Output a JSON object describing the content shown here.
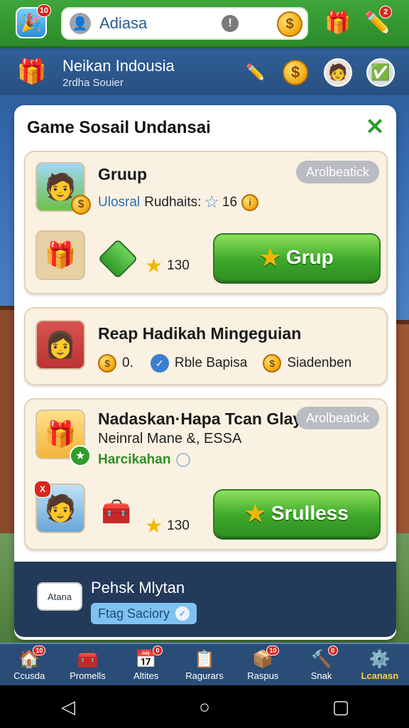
{
  "topbar": {
    "app_badge": "10",
    "search_value": "Adiasa",
    "alert_glyph": "!",
    "coin_glyph": "$",
    "gift_badge": "",
    "pencil_badge": "2"
  },
  "profile": {
    "name": "Neikan Indousia",
    "subtitle": "2rdha Souier"
  },
  "panel": {
    "title": "Game Sosail Undansai",
    "close_glyph": "✕"
  },
  "card1": {
    "title": "Gruup",
    "pill": "Arolbeatick",
    "line_blue": "Ulosral",
    "line_text": "Rudhaits:",
    "line_num": "16",
    "stars": "130",
    "button": "Grup"
  },
  "card2": {
    "title": "Reap Hadikah Mingeguian",
    "v1": "0.",
    "v2": "Rble Bapisa",
    "v3": "Siadenben"
  },
  "card3": {
    "title": "Nadaskan·Hapa Tcan Glay",
    "pill": "Arolbeatick",
    "sub": "Neinral Mane &, ESSA",
    "green_text": "Harcikahan",
    "badge": "X",
    "stars": "130",
    "button": "Srulless"
  },
  "promo": {
    "icon_text": "Atana",
    "title": "Pehsk Mlytan",
    "button": "Ftag Saciory"
  },
  "nav": {
    "items": [
      {
        "label": "Ccusda",
        "badge": "10"
      },
      {
        "label": "Promells",
        "badge": ""
      },
      {
        "label": "Altites",
        "badge": "0"
      },
      {
        "label": "Ragurars",
        "badge": ""
      },
      {
        "label": "Raspus",
        "badge": "10"
      },
      {
        "label": "Snak",
        "badge": "0"
      },
      {
        "label": "Lcanasn",
        "badge": ""
      }
    ]
  },
  "colors": {
    "accent_green": "#3ea82b",
    "nav_active": "#ffcf3a"
  }
}
